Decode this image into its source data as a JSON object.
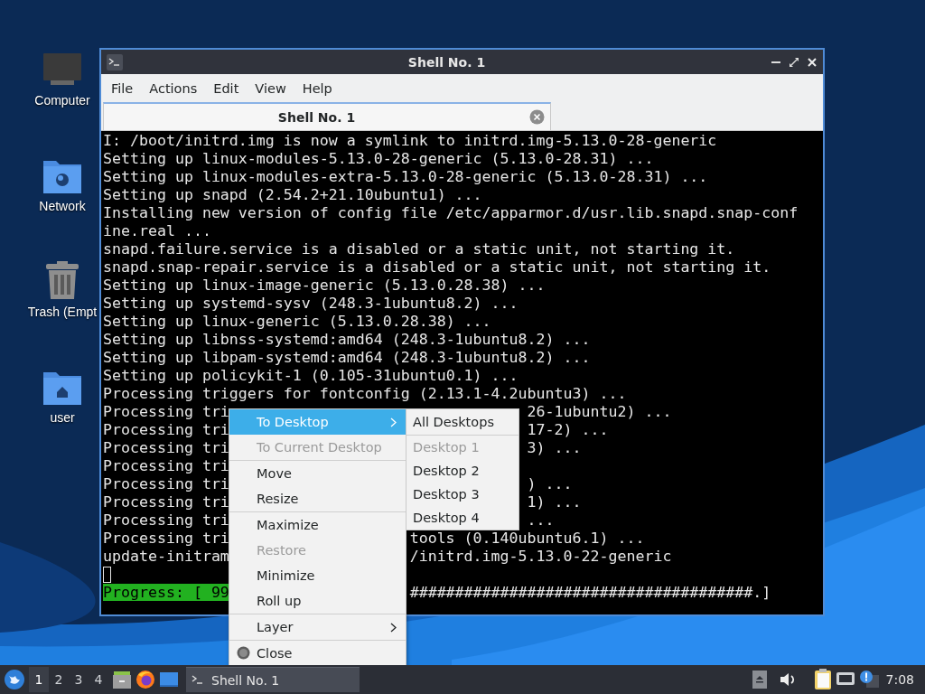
{
  "desktop_icons": [
    {
      "label": "Computer",
      "kind": "computer"
    },
    {
      "label": "Network",
      "kind": "network"
    },
    {
      "label": "Trash (Empt",
      "kind": "trash"
    },
    {
      "label": "user",
      "kind": "home"
    }
  ],
  "window": {
    "title": "Shell No. 1",
    "menu": [
      "File",
      "Actions",
      "Edit",
      "View",
      "Help"
    ],
    "tabs": [
      {
        "label": "Shell No. 1",
        "selected": true
      }
    ],
    "terminal": {
      "lines": [
        {
          "kind": "text",
          "text": "I: /boot/initrd.img is now a symlink to initrd.img-5.13.0-28-generic"
        },
        {
          "kind": "text",
          "text": "Setting up linux-modules-5.13.0-28-generic (5.13.0-28.31) ..."
        },
        {
          "kind": "text",
          "text": "Setting up linux-modules-extra-5.13.0-28-generic (5.13.0-28.31) ..."
        },
        {
          "kind": "text",
          "text": "Setting up snapd (2.54.2+21.10ubuntu1) ..."
        },
        {
          "kind": "text",
          "text": "Installing new version of config file /etc/apparmor.d/usr.lib.snapd.snap-conf"
        },
        {
          "kind": "text",
          "text": "ine.real ..."
        },
        {
          "kind": "text",
          "text": "snapd.failure.service is a disabled or a static unit, not starting it."
        },
        {
          "kind": "text",
          "text": "snapd.snap-repair.service is a disabled or a static unit, not starting it."
        },
        {
          "kind": "text",
          "text": "Setting up linux-image-generic (5.13.0.28.38) ..."
        },
        {
          "kind": "text",
          "text": "Setting up systemd-sysv (248.3-1ubuntu8.2) ..."
        },
        {
          "kind": "text",
          "text": "Setting up linux-generic (5.13.0.28.38) ..."
        },
        {
          "kind": "text",
          "text": "Setting up libnss-systemd:amd64 (248.3-1ubuntu8.2) ..."
        },
        {
          "kind": "text",
          "text": "Setting up libpam-systemd:amd64 (248.3-1ubuntu8.2) ..."
        },
        {
          "kind": "text",
          "text": "Setting up policykit-1 (0.105-31ubuntu0.1) ..."
        },
        {
          "kind": "text",
          "text": "Processing triggers for fontconfig (2.13.1-4.2ubuntu3) ..."
        },
        {
          "kind": "text",
          "text": "Processing tri",
          "right": "26-1ubuntu2) ..."
        },
        {
          "kind": "text",
          "text": "Processing tri",
          "right": "17-2) ..."
        },
        {
          "kind": "text",
          "text": "Processing tri",
          "right": "3) ..."
        },
        {
          "kind": "text",
          "text": "Processing tri"
        },
        {
          "kind": "text",
          "text": "Processing tri",
          "right": ") ..."
        },
        {
          "kind": "text",
          "text": "Processing tri",
          "right": "1) ..."
        },
        {
          "kind": "text",
          "text": "Processing tri",
          "right": "..."
        },
        {
          "kind": "text",
          "text": "Processing tri",
          "right": "tools (0.140ubuntu6.1) ..."
        },
        {
          "kind": "text",
          "text": "update-initram",
          "right": "/initrd.img-5.13.0-22-generic"
        },
        {
          "kind": "cursor"
        },
        {
          "kind": "progress",
          "text": "Progress: [ 99",
          "right": "######################################.]"
        }
      ]
    }
  },
  "context_menu": {
    "items": [
      {
        "kind": "item",
        "label": "To Desktop",
        "selected": true,
        "disabled": false,
        "submenu": true
      },
      {
        "kind": "item",
        "label": "To Current Desktop",
        "selected": false,
        "disabled": true,
        "submenu": false
      },
      {
        "kind": "separator"
      },
      {
        "kind": "item",
        "label": "Move",
        "selected": false,
        "disabled": false,
        "submenu": false
      },
      {
        "kind": "item",
        "label": "Resize",
        "selected": false,
        "disabled": false,
        "submenu": false
      },
      {
        "kind": "separator"
      },
      {
        "kind": "item",
        "label": "Maximize",
        "selected": false,
        "disabled": false,
        "submenu": false
      },
      {
        "kind": "item",
        "label": "Restore",
        "selected": false,
        "disabled": true,
        "submenu": false
      },
      {
        "kind": "item",
        "label": "Minimize",
        "selected": false,
        "disabled": false,
        "submenu": false
      },
      {
        "kind": "item",
        "label": "Roll up",
        "selected": false,
        "disabled": false,
        "submenu": false
      },
      {
        "kind": "separator"
      },
      {
        "kind": "item",
        "label": "Layer",
        "selected": false,
        "disabled": false,
        "submenu": true
      },
      {
        "kind": "separator"
      },
      {
        "kind": "close",
        "label": "Close",
        "selected": false,
        "disabled": false,
        "submenu": false
      }
    ]
  },
  "submenu": {
    "items": [
      {
        "kind": "item",
        "label": "All Desktops",
        "selected": false,
        "disabled": false
      },
      {
        "kind": "separator"
      },
      {
        "kind": "item",
        "label": "Desktop 1",
        "selected": false,
        "disabled": true
      },
      {
        "kind": "item",
        "label": "Desktop 2",
        "selected": false,
        "disabled": false
      },
      {
        "kind": "item",
        "label": "Desktop 3",
        "selected": false,
        "disabled": false
      },
      {
        "kind": "item",
        "label": "Desktop 4",
        "selected": false,
        "disabled": false
      }
    ]
  },
  "taskbar": {
    "workspaces": [
      {
        "label": "1",
        "selected": true
      },
      {
        "label": "2",
        "selected": false
      },
      {
        "label": "3",
        "selected": false
      },
      {
        "label": "4",
        "selected": false
      }
    ],
    "tasks": [
      {
        "label": "Shell No. 1",
        "selected": true
      }
    ],
    "clock": "7:08"
  }
}
